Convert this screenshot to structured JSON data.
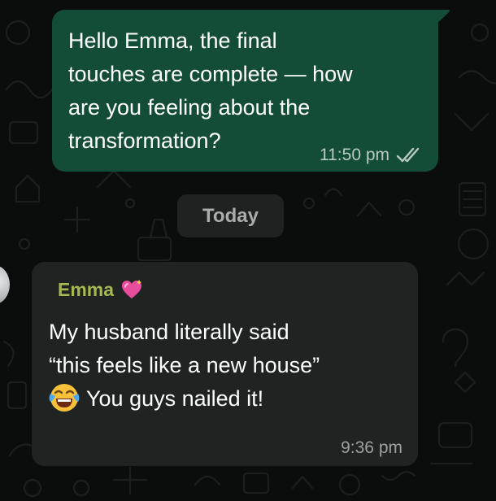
{
  "conversation": {
    "outgoing": {
      "text": "Hello Emma, the final\ntouches are complete — how\nare you feeling about the\ntransformation?",
      "time": "11:50 pm",
      "status_icon": "double-check-read-icon"
    },
    "date_separator": "Today",
    "incoming": {
      "sender": "Emma",
      "sender_badge_icon": "sparkling-heart-icon",
      "line1": "My husband literally said",
      "line2": "“this feels like a new house”",
      "line3_emoji_icon": "face-with-tears-of-joy-icon",
      "line3": "You guys nailed it!",
      "time": "9:36 pm"
    }
  },
  "colors": {
    "background": "#0b0d0c",
    "outgoing_bubble": "#144d37",
    "incoming_bubble": "#1f2322",
    "sender_name": "#a4b84f",
    "date_pill": "#1e2221"
  }
}
